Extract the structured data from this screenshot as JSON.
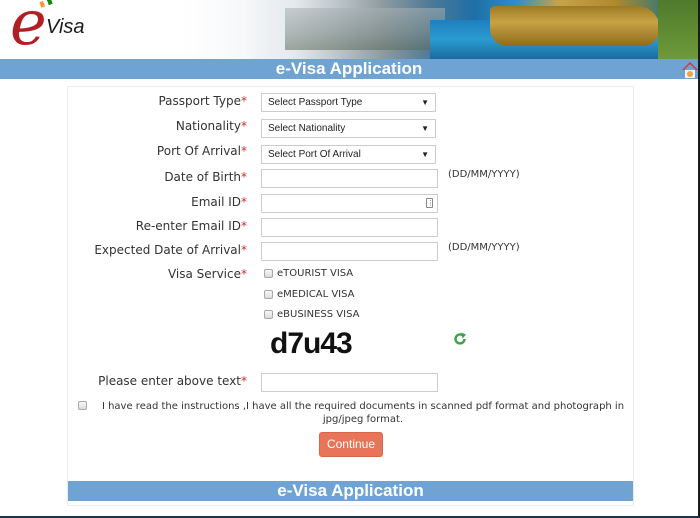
{
  "header": {
    "logo_e": "e",
    "logo_visa": "Visa",
    "title": "e-Visa Application"
  },
  "form": {
    "passport_type": {
      "label": "Passport Type",
      "required": "*",
      "value": "Select Passport Type"
    },
    "nationality": {
      "label": "Nationality",
      "required": "*",
      "value": "Select Nationality"
    },
    "port_of_arrival": {
      "label": "Port Of Arrival",
      "required": "*",
      "value": "Select Port Of Arrival"
    },
    "date_of_birth": {
      "label": "Date of Birth",
      "required": "*",
      "value": "",
      "hint": "(DD/MM/YYYY)"
    },
    "email": {
      "label": "Email ID",
      "required": "*",
      "value": ""
    },
    "reenter_email": {
      "label": "Re-enter Email ID",
      "required": "*",
      "value": ""
    },
    "expected_arrival": {
      "label": "Expected Date of Arrival",
      "required": "*",
      "value": "",
      "hint": "(DD/MM/YYYY)"
    },
    "visa_service": {
      "label": "Visa Service",
      "required": "*",
      "options": [
        {
          "label": "eTOURIST VISA",
          "checked": false
        },
        {
          "label": "eMEDICAL VISA",
          "checked": false
        },
        {
          "label": "eBUSINESS VISA",
          "checked": false
        }
      ]
    },
    "captcha": {
      "text": "d7u43",
      "refresh_icon": "refresh-icon"
    },
    "captcha_input": {
      "label": "Please enter above text",
      "required": "*",
      "value": ""
    },
    "agreement": {
      "checked": false,
      "text": "I have read the instructions ,I have all the required documents in scanned pdf format and photograph in jpg/jpeg format."
    },
    "continue_label": "Continue"
  },
  "footer": {
    "title": "e-Visa Application"
  },
  "colors": {
    "bar_blue": "#6fa3d3",
    "required_red": "#c9302c",
    "continue_orange": "#e8745a",
    "refresh_green": "#3aa345",
    "logo_red": "#b11e23"
  }
}
